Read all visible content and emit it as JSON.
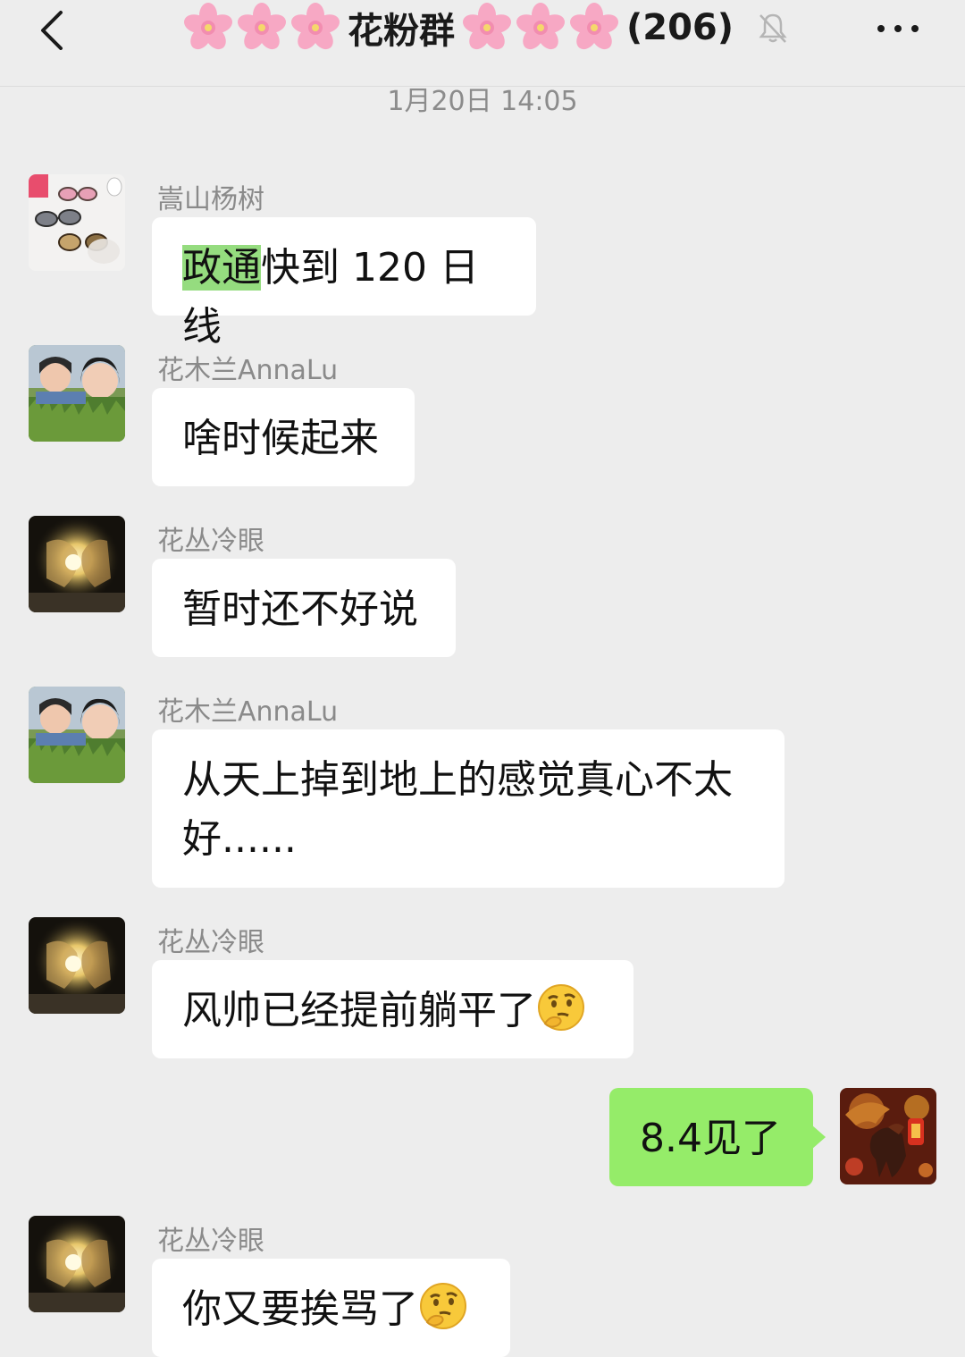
{
  "header": {
    "back_icon": "chevron-left-icon",
    "title": "花粉群",
    "decoration_icon": "cherry-blossom-icon",
    "member_count": "(206)",
    "mute_icon": "bell-slash-icon",
    "more_icon": "ellipsis-icon"
  },
  "timestamp": "1月20日 14:05",
  "messages": [
    {
      "sender": "嵩山杨树",
      "avatar": "sunglasses-avatar",
      "highlight": "政通",
      "text": "快到 120 日线"
    },
    {
      "sender": "花木兰AnnaLu",
      "avatar": "girls-photo-avatar",
      "text": "啥时候起来"
    },
    {
      "sender": "花丛冷眼",
      "avatar": "glowing-hands-avatar",
      "text": "暂时还不好说"
    },
    {
      "sender": "花木兰AnnaLu",
      "avatar": "girls-photo-avatar",
      "text": "从天上掉到地上的感觉真心不太好......"
    },
    {
      "sender": "花丛冷眼",
      "avatar": "glowing-hands-avatar",
      "text": "风帅已经提前躺平了",
      "emoji": "thinking-face-emoji"
    },
    {
      "sender": "me",
      "avatar": "dragon-horse-avatar",
      "text": "8.4见了"
    },
    {
      "sender": "花丛冷眼",
      "avatar": "glowing-hands-avatar",
      "text": "你又要挨骂了",
      "emoji": "thinking-face-emoji"
    }
  ],
  "colors": {
    "background": "#ededed",
    "bubble_other": "#ffffff",
    "bubble_self": "#95ec69",
    "highlight": "#95dc7f",
    "sender_name": "#8a8a8a"
  }
}
